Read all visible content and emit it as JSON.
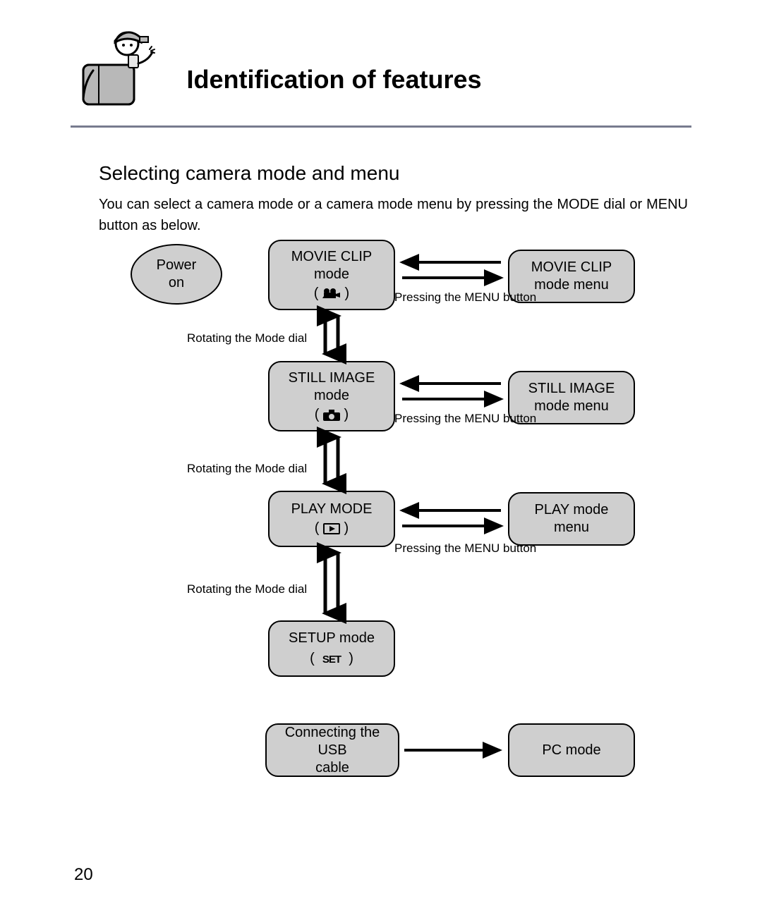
{
  "title": "Identification of features",
  "section_title": "Selecting camera mode and menu",
  "body_text": "You can select a camera mode or a camera mode menu by pressing the MODE dial or MENU button as below.",
  "nodes": {
    "power": "Power\non",
    "movie_mode": "MOVIE CLIP\nmode",
    "movie_menu": "MOVIE CLIP\nmode menu",
    "still_mode": "STILL IMAGE\nmode",
    "still_menu": "STILL IMAGE\nmode menu",
    "play_mode": "PLAY MODE",
    "play_menu": "PLAY mode\nmenu",
    "setup_mode": "SETUP mode",
    "usb": "Connecting the USB\ncable",
    "pc_mode": "PC mode"
  },
  "captions": {
    "rotate_dial": "Rotating the Mode dial",
    "press_menu": "Pressing the MENU button"
  },
  "icon_set_text": "SET",
  "page_number": "20"
}
